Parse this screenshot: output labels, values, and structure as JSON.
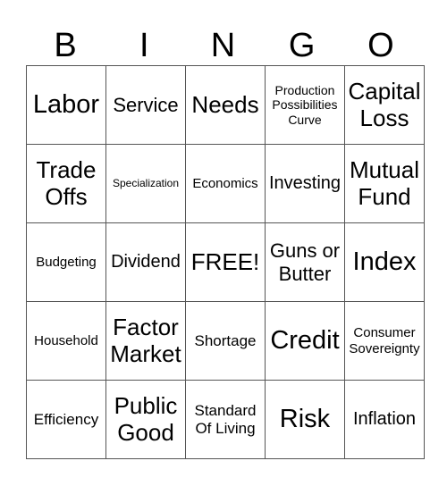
{
  "header": {
    "letters": [
      "B",
      "I",
      "N",
      "G",
      "O"
    ]
  },
  "rows": [
    [
      "Labor",
      "Service",
      "Needs",
      "Production Possibilities Curve",
      "Capital Loss"
    ],
    [
      "Trade Offs",
      "Specialization",
      "Economics",
      "Investing",
      "Mutual Fund"
    ],
    [
      "Budgeting",
      "Dividend",
      "FREE!",
      "Guns or Butter",
      "Index"
    ],
    [
      "Household",
      "Factor Market",
      "Shortage",
      "Credit",
      "Consumer Sovereignty"
    ],
    [
      "Efficiency",
      "Public Good",
      "Standard Of Living",
      "Risk",
      "Inflation"
    ]
  ]
}
